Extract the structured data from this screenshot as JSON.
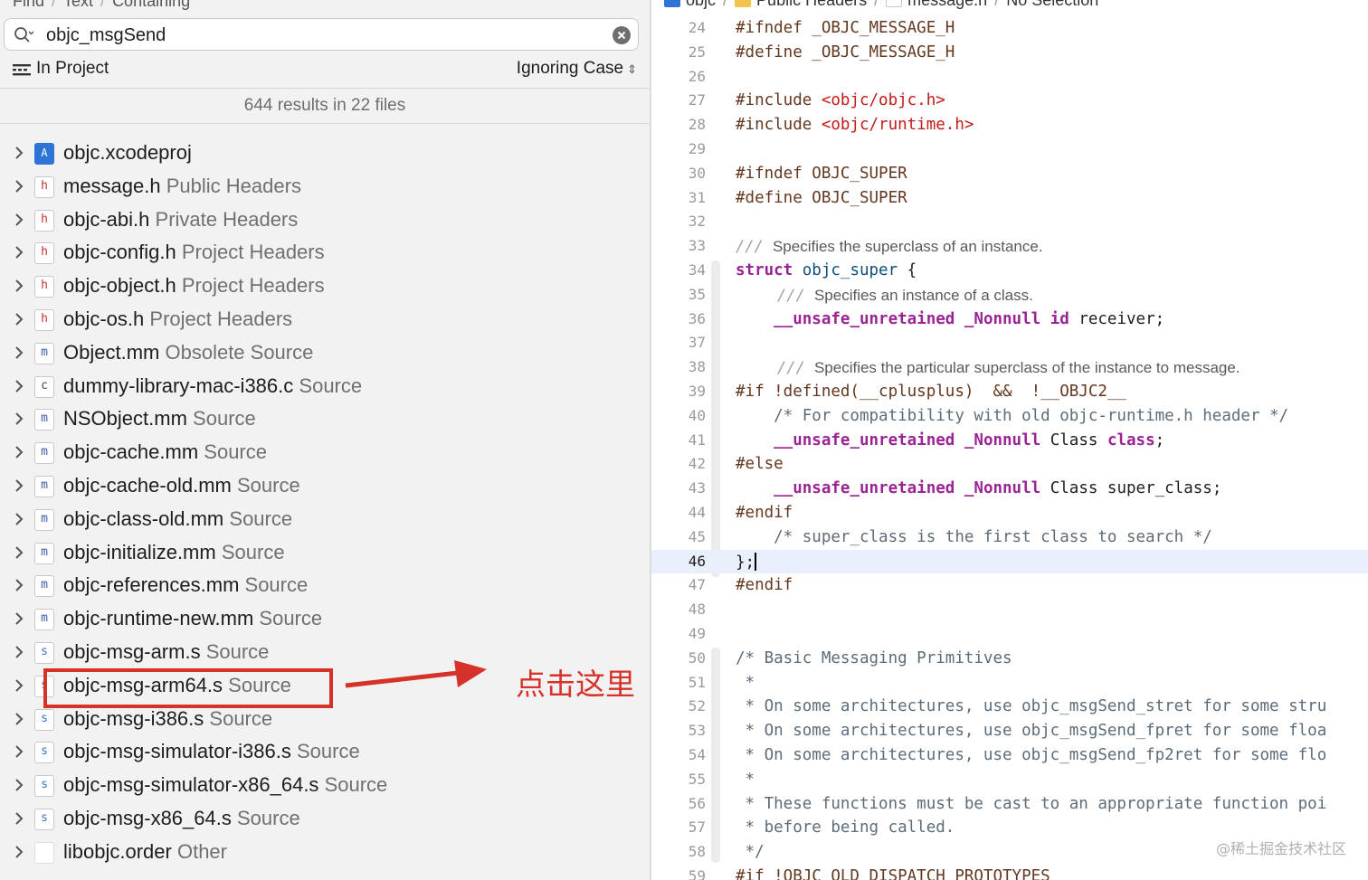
{
  "find_navigator": {
    "breadcrumb": [
      "Find",
      "Text",
      "Containing"
    ],
    "search": {
      "value": "objc_msgSend",
      "placeholder": ""
    },
    "scope_label": "In Project",
    "case_label": "Ignoring Case",
    "summary": "644 results in 22 files",
    "results": [
      {
        "icon": "proj",
        "icon_char": "A",
        "name": "objc.xcodeproj",
        "group": ""
      },
      {
        "icon": "h",
        "icon_char": "h",
        "name": "message.h",
        "group": "Public Headers"
      },
      {
        "icon": "h",
        "icon_char": "h",
        "name": "objc-abi.h",
        "group": "Private Headers"
      },
      {
        "icon": "h",
        "icon_char": "h",
        "name": "objc-config.h",
        "group": "Project Headers"
      },
      {
        "icon": "h",
        "icon_char": "h",
        "name": "objc-object.h",
        "group": "Project Headers"
      },
      {
        "icon": "h",
        "icon_char": "h",
        "name": "objc-os.h",
        "group": "Project Headers"
      },
      {
        "icon": "m",
        "icon_char": "m",
        "name": "Object.mm",
        "group": "Obsolete Source"
      },
      {
        "icon": "c",
        "icon_char": "c",
        "name": "dummy-library-mac-i386.c",
        "group": "Source"
      },
      {
        "icon": "m",
        "icon_char": "m",
        "name": "NSObject.mm",
        "group": "Source"
      },
      {
        "icon": "m",
        "icon_char": "m",
        "name": "objc-cache.mm",
        "group": "Source"
      },
      {
        "icon": "m",
        "icon_char": "m",
        "name": "objc-cache-old.mm",
        "group": "Source"
      },
      {
        "icon": "m",
        "icon_char": "m",
        "name": "objc-class-old.mm",
        "group": "Source"
      },
      {
        "icon": "m",
        "icon_char": "m",
        "name": "objc-initialize.mm",
        "group": "Source"
      },
      {
        "icon": "m",
        "icon_char": "m",
        "name": "objc-references.mm",
        "group": "Source"
      },
      {
        "icon": "m",
        "icon_char": "m",
        "name": "objc-runtime-new.mm",
        "group": "Source"
      },
      {
        "icon": "s",
        "icon_char": "s",
        "name": "objc-msg-arm.s",
        "group": "Source"
      },
      {
        "icon": "s",
        "icon_char": "s",
        "name": "objc-msg-arm64.s",
        "group": "Source"
      },
      {
        "icon": "s",
        "icon_char": "s",
        "name": "objc-msg-i386.s",
        "group": "Source"
      },
      {
        "icon": "s",
        "icon_char": "s",
        "name": "objc-msg-simulator-i386.s",
        "group": "Source"
      },
      {
        "icon": "s",
        "icon_char": "s",
        "name": "objc-msg-simulator-x86_64.s",
        "group": "Source"
      },
      {
        "icon": "s",
        "icon_char": "s",
        "name": "objc-msg-x86_64.s",
        "group": "Source"
      },
      {
        "icon": "o",
        "icon_char": "",
        "name": "libobjc.order",
        "group": "Other"
      }
    ]
  },
  "annotation": {
    "text": "点击这里",
    "color": "#d6322a"
  },
  "jump_bar": [
    "objc",
    "Public Headers",
    "message.h",
    "No Selection"
  ],
  "editor": {
    "current_line": 46,
    "lines": [
      {
        "n": 24,
        "t": [
          [
            "pp",
            "#ifndef _OBJC_MESSAGE_H"
          ]
        ]
      },
      {
        "n": 25,
        "t": [
          [
            "pp",
            "#define _OBJC_MESSAGE_H"
          ]
        ]
      },
      {
        "n": 26,
        "t": []
      },
      {
        "n": 27,
        "t": [
          [
            "pp",
            "#include "
          ],
          [
            "str",
            "<objc/objc.h>"
          ]
        ]
      },
      {
        "n": 28,
        "t": [
          [
            "pp",
            "#include "
          ],
          [
            "str",
            "<objc/runtime.h>"
          ]
        ]
      },
      {
        "n": 29,
        "t": []
      },
      {
        "n": 30,
        "t": [
          [
            "pp",
            "#ifndef OBJC_SUPER"
          ]
        ]
      },
      {
        "n": 31,
        "t": [
          [
            "pp",
            "#define OBJC_SUPER"
          ]
        ]
      },
      {
        "n": 32,
        "t": []
      },
      {
        "n": 33,
        "doc": "Specifies the superclass of an instance.",
        "indent": 0
      },
      {
        "n": 34,
        "t": [
          [
            "kw",
            "struct"
          ],
          [
            "pl",
            " "
          ],
          [
            "ty",
            "objc_super"
          ],
          [
            "pl",
            " {"
          ]
        ]
      },
      {
        "n": 35,
        "doc": "Specifies an instance of a class.",
        "indent": 1
      },
      {
        "n": 36,
        "t": [
          [
            "pl",
            "    "
          ],
          [
            "kw",
            "__unsafe_unretained _Nonnull id"
          ],
          [
            "pl",
            " receiver;"
          ]
        ]
      },
      {
        "n": 37,
        "t": []
      },
      {
        "n": 38,
        "doc": "Specifies the particular superclass of the instance to message.",
        "indent": 1
      },
      {
        "n": 39,
        "t": [
          [
            "pp",
            "#if !defined(__cplusplus)  &&  !__OBJC2__"
          ]
        ]
      },
      {
        "n": 40,
        "t": [
          [
            "cm",
            "    /* For compatibility with old objc-runtime.h header */"
          ]
        ]
      },
      {
        "n": 41,
        "t": [
          [
            "pl",
            "    "
          ],
          [
            "kw",
            "__unsafe_unretained _Nonnull"
          ],
          [
            "pl",
            " Class "
          ],
          [
            "kw",
            "class"
          ],
          [
            "pl",
            ";"
          ]
        ]
      },
      {
        "n": 42,
        "t": [
          [
            "pp",
            "#else"
          ]
        ]
      },
      {
        "n": 43,
        "t": [
          [
            "pl",
            "    "
          ],
          [
            "kw",
            "__unsafe_unretained _Nonnull"
          ],
          [
            "pl",
            " Class super_class;"
          ]
        ]
      },
      {
        "n": 44,
        "t": [
          [
            "pp",
            "#endif"
          ]
        ]
      },
      {
        "n": 45,
        "t": [
          [
            "cm",
            "    /* super_class is the first class to search */"
          ]
        ]
      },
      {
        "n": 46,
        "t": [
          [
            "pl",
            "};"
          ]
        ],
        "caret": true
      },
      {
        "n": 47,
        "t": [
          [
            "pp",
            "#endif"
          ]
        ]
      },
      {
        "n": 48,
        "t": []
      },
      {
        "n": 49,
        "t": []
      },
      {
        "n": 50,
        "t": [
          [
            "cm",
            "/* Basic Messaging Primitives"
          ]
        ]
      },
      {
        "n": 51,
        "t": [
          [
            "cm",
            " *"
          ]
        ]
      },
      {
        "n": 52,
        "t": [
          [
            "cm",
            " * On some architectures, use objc_msgSend_stret for some stru"
          ]
        ]
      },
      {
        "n": 53,
        "t": [
          [
            "cm",
            " * On some architectures, use objc_msgSend_fpret for some floa"
          ]
        ]
      },
      {
        "n": 54,
        "t": [
          [
            "cm",
            " * On some architectures, use objc_msgSend_fp2ret for some flo"
          ]
        ]
      },
      {
        "n": 55,
        "t": [
          [
            "cm",
            " *"
          ]
        ]
      },
      {
        "n": 56,
        "t": [
          [
            "cm",
            " * These functions must be cast to an appropriate function poi"
          ]
        ]
      },
      {
        "n": 57,
        "t": [
          [
            "cm",
            " * before being called."
          ]
        ]
      },
      {
        "n": 58,
        "t": [
          [
            "cm",
            " */"
          ]
        ]
      },
      {
        "n": 59,
        "t": [
          [
            "pp",
            "#if !OBJC_OLD_DISPATCH_PROTOTYPES"
          ]
        ]
      }
    ]
  },
  "colors": {
    "keyword": "#9b2393",
    "preprocessor": "#643820",
    "string": "#c41a16",
    "type": "#0b4f79",
    "comment": "#5d6c79",
    "doc_text": "#5a5a5a"
  },
  "watermark": "@稀土掘金技术社区"
}
